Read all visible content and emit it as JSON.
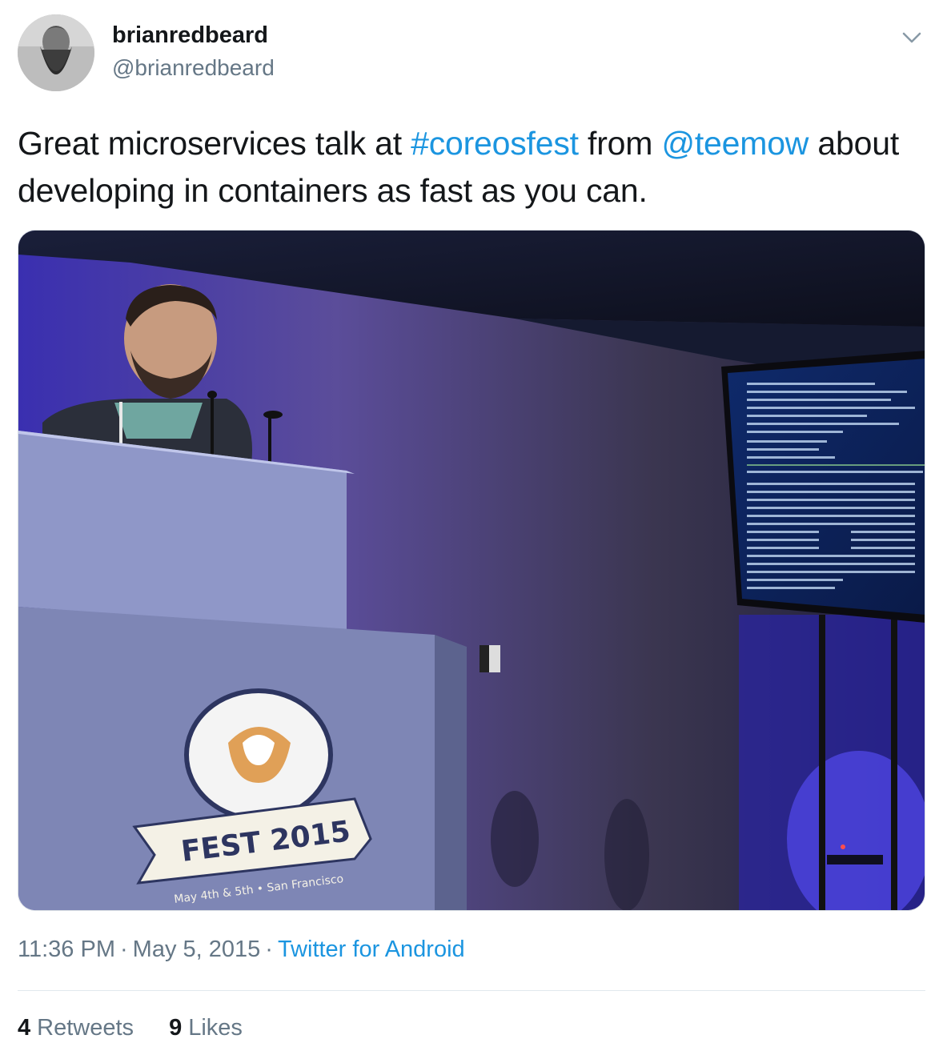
{
  "user": {
    "display_name": "brianredbeard",
    "handle": "@brianredbeard"
  },
  "tweet": {
    "text_part1": "Great microservices talk at ",
    "hashtag": "#coreosfest",
    "text_part2": " from ",
    "mention": "@teemow",
    "text_part3": " about developing in containers as fast as you can."
  },
  "photo": {
    "podium_title": "FEST 2015",
    "podium_subtitle": "May 4th & 5th • San Francisco"
  },
  "meta": {
    "time": "11:36 PM",
    "date": "May 5, 2015",
    "separator": "·",
    "source": "Twitter for Android"
  },
  "stats": {
    "retweets_count": "4",
    "retweets_label": "Retweets",
    "likes_count": "9",
    "likes_label": "Likes"
  },
  "colors": {
    "link": "#1b95e0",
    "secondary_text": "#657786",
    "primary_text": "#14171a"
  }
}
